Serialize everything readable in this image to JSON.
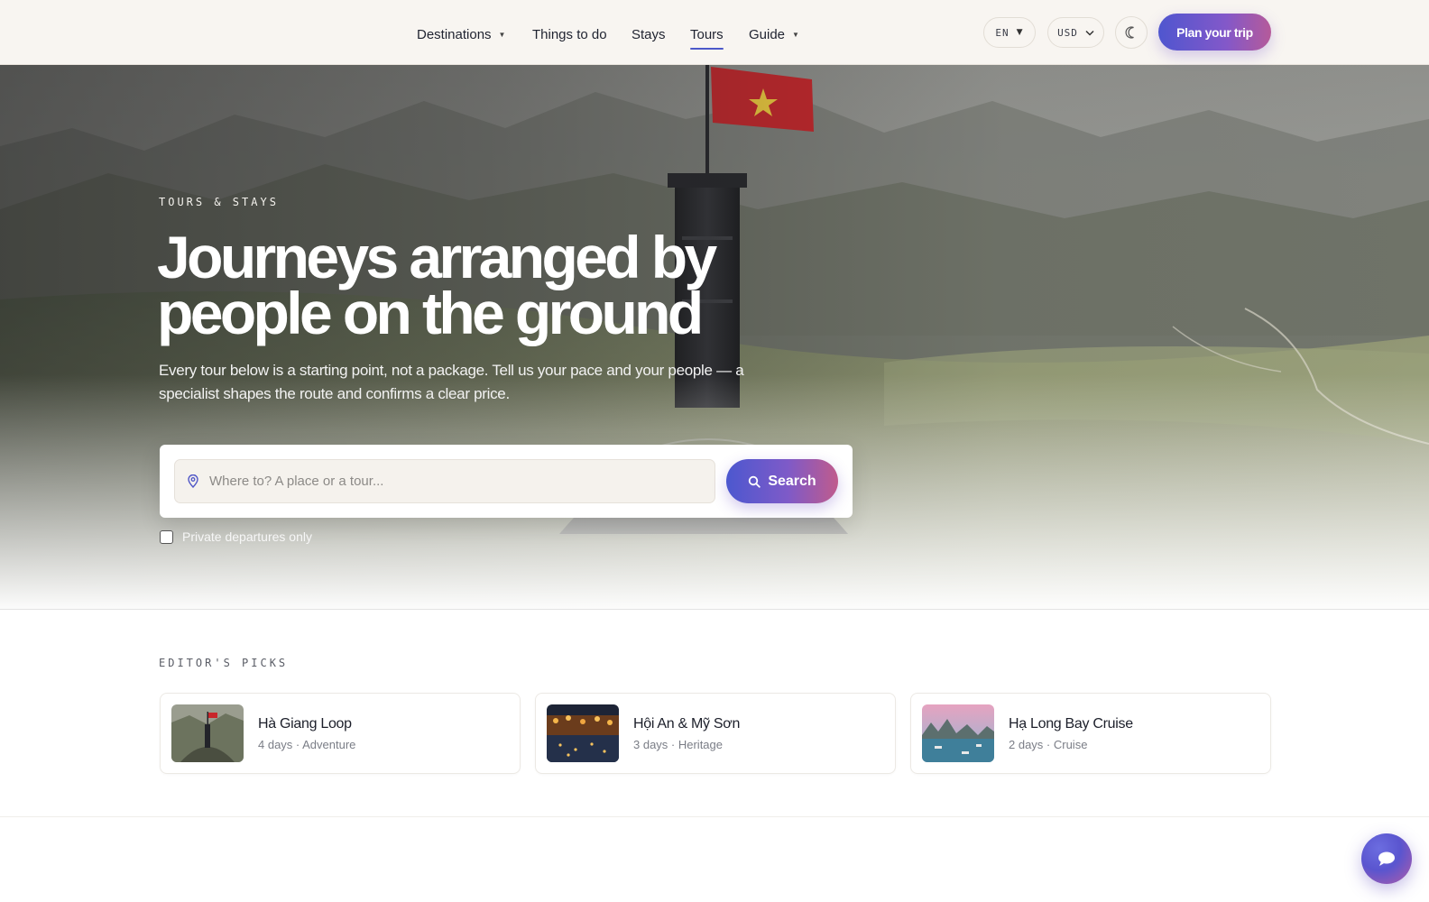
{
  "header": {
    "nav": [
      {
        "label": "Destinations",
        "has_dropdown": true,
        "active": false
      },
      {
        "label": "Things to do",
        "has_dropdown": false,
        "active": false
      },
      {
        "label": "Stays",
        "has_dropdown": false,
        "active": false
      },
      {
        "label": "Tours",
        "has_dropdown": false,
        "active": true
      },
      {
        "label": "Guide",
        "has_dropdown": true,
        "active": false
      }
    ],
    "language": "EN",
    "currency": "USD",
    "theme_icon": "moon-icon",
    "cta_label": "Plan your trip"
  },
  "hero": {
    "eyebrow": "TOURS & STAYS",
    "title_line1": "Journeys arranged by",
    "title_line2": "people on the ground",
    "subtitle": "Every tour below is a starting point, not a package. Tell us your pace and your people — a specialist shapes the route and confirms a clear price.",
    "search": {
      "placeholder": "Where to? A place or a tour...",
      "value": "",
      "button_label": "Search",
      "field_icon": "map-pin-icon",
      "button_icon": "search-icon"
    },
    "private_only": {
      "label": "Private departures only",
      "checked": false
    }
  },
  "picks": {
    "eyebrow": "EDITOR'S PICKS",
    "items": [
      {
        "name": "Hà Giang Loop",
        "meta": "4 days · Adventure"
      },
      {
        "name": "Hội An & Mỹ Sơn",
        "meta": "3 days · Heritage"
      },
      {
        "name": "Hạ Long Bay Cruise",
        "meta": "2 days · Cruise"
      }
    ]
  },
  "chat": {
    "icon": "chat-bubble-icon"
  },
  "colors": {
    "accent": "#4c58cf",
    "accent_end": "#c05b8c",
    "header_bg": "#f8f5f1",
    "flag_red": "#c8262b",
    "flag_star": "#f4d03f"
  }
}
